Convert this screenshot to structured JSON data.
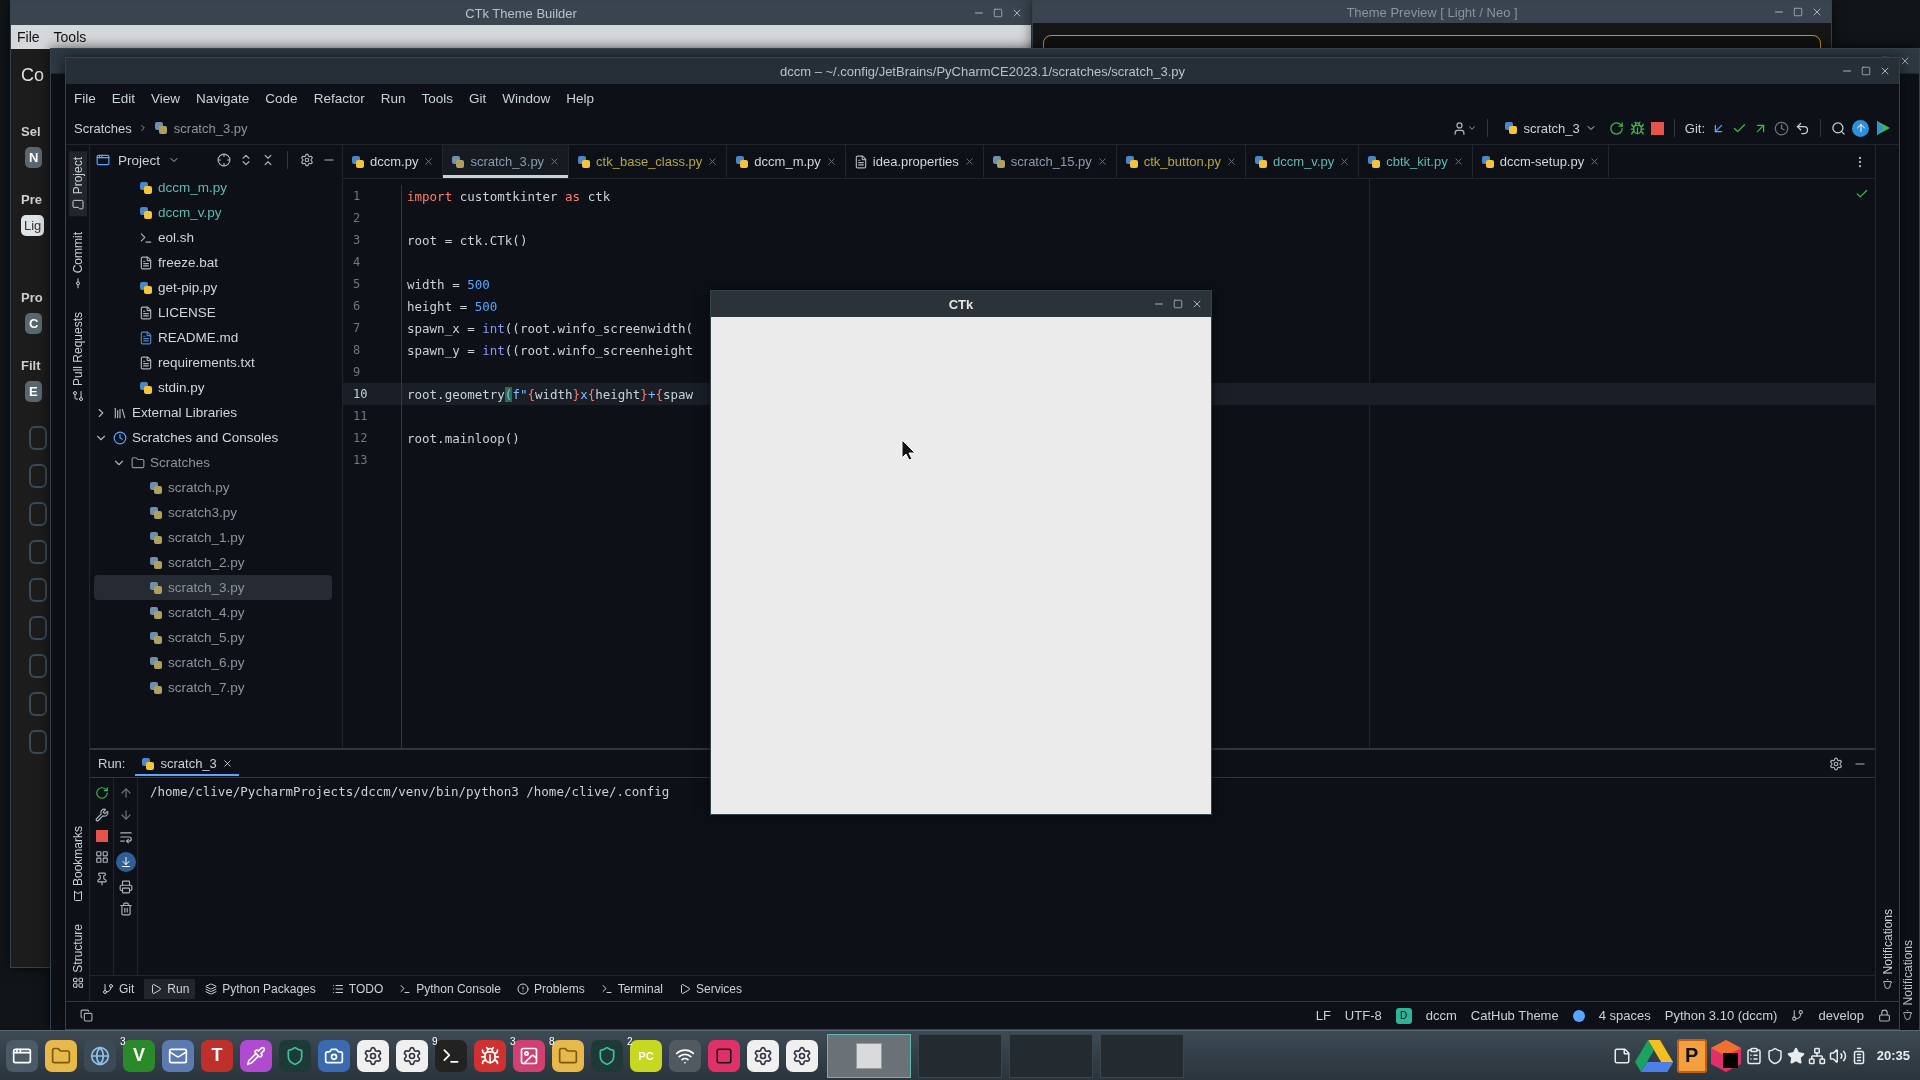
{
  "theme_builder": {
    "title": "CTk Theme Builder",
    "menu": [
      "File",
      "Tools"
    ],
    "fragments": [
      {
        "kind": "heading",
        "text": "Co"
      },
      {
        "kind": "label",
        "text": "Sel"
      },
      {
        "kind": "button",
        "text": "N"
      },
      {
        "kind": "label",
        "text": "Pre"
      },
      {
        "kind": "field",
        "text": "Lig"
      },
      {
        "kind": "label",
        "text": "Pro"
      },
      {
        "kind": "button",
        "text": "C"
      },
      {
        "kind": "label",
        "text": "Filt"
      },
      {
        "kind": "button",
        "text": "E"
      }
    ]
  },
  "theme_preview": {
    "title": "Theme Preview [ Light / Neo ]"
  },
  "background_ide": {
    "notifications": "Notifications"
  },
  "ide": {
    "title": "dccm – ~/.config/JetBrains/PyCharmCE2023.1/scratches/scratch_3.py",
    "menu": [
      "File",
      "Edit",
      "View",
      "Navigate",
      "Code",
      "Refactor",
      "Run",
      "Tools",
      "Git",
      "Window",
      "Help"
    ],
    "breadcrumbs": [
      "Scratches",
      "scratch_3.py"
    ],
    "run_config": "scratch_3",
    "git_label": "Git:",
    "left_strip_top": [
      {
        "label": "Project",
        "kind": "folder",
        "selected": true
      },
      {
        "label": "Commit",
        "kind": "commit",
        "selected": false
      },
      {
        "label": "Pull Requests",
        "kind": "pull",
        "selected": false
      }
    ],
    "left_strip_bottom": [
      {
        "label": "Bookmarks",
        "kind": "bookmark",
        "selected": false
      },
      {
        "label": "Structure",
        "kind": "structure",
        "selected": false
      }
    ],
    "project_panel": {
      "title": "Project",
      "files": [
        {
          "label": "dccm_m.py",
          "kind": "python",
          "color": "#5fb9b0",
          "selected": false
        },
        {
          "label": "dccm_v.py",
          "kind": "python",
          "color": "#5fb9b0",
          "selected": false
        },
        {
          "label": "eol.sh",
          "kind": "shell",
          "color": "#d0d6dc",
          "selected": false
        },
        {
          "label": "freeze.bat",
          "kind": "text",
          "color": "#d0d6dc",
          "selected": false
        },
        {
          "label": "get-pip.py",
          "kind": "python",
          "color": "#d0d6dc",
          "selected": false
        },
        {
          "label": "LICENSE",
          "kind": "text",
          "color": "#d0d6dc",
          "selected": false
        },
        {
          "label": "README.md",
          "kind": "markdown",
          "color": "#d0d6dc",
          "selected": false
        },
        {
          "label": "requirements.txt",
          "kind": "text",
          "color": "#d0d6dc",
          "selected": false
        },
        {
          "label": "stdin.py",
          "kind": "python",
          "color": "#d0d6dc",
          "selected": false
        }
      ],
      "tree": [
        {
          "label": "External Libraries",
          "kind": "library",
          "color": "#d0d6dc",
          "expanded": false,
          "selected": false
        },
        {
          "label": "Scratches and Consoles",
          "kind": "scratches",
          "color": "#d0d6dc",
          "expanded": true,
          "selected": false,
          "children": [
            {
              "label": "Scratches",
              "kind": "folder",
              "color": "#8b949e",
              "expanded": true,
              "selected": false,
              "children": [
                {
                  "label": "scratch.py",
                  "kind": "scratch",
                  "color": "#8b949e",
                  "selected": false
                },
                {
                  "label": "scratch3.py",
                  "kind": "scratch",
                  "color": "#8b949e",
                  "selected": false
                },
                {
                  "label": "scratch_1.py",
                  "kind": "scratch",
                  "color": "#8b949e",
                  "selected": false
                },
                {
                  "label": "scratch_2.py",
                  "kind": "scratch",
                  "color": "#8b949e",
                  "selected": false
                },
                {
                  "label": "scratch_3.py",
                  "kind": "scratch",
                  "color": "#8b949e",
                  "selected": true
                },
                {
                  "label": "scratch_4.py",
                  "kind": "scratch",
                  "color": "#8b949e",
                  "selected": false
                },
                {
                  "label": "scratch_5.py",
                  "kind": "scratch",
                  "color": "#8b949e",
                  "selected": false
                },
                {
                  "label": "scratch_6.py",
                  "kind": "scratch",
                  "color": "#8b949e",
                  "selected": false
                },
                {
                  "label": "scratch_7.py",
                  "kind": "scratch",
                  "color": "#8b949e",
                  "selected": false
                }
              ]
            }
          ]
        }
      ]
    },
    "tabs": [
      {
        "label": "dccm.py",
        "kind": "python",
        "color": "#d0d6dc",
        "selected": false
      },
      {
        "label": "scratch_3.py",
        "kind": "scratch",
        "color": "#8a9bb0",
        "selected": true
      },
      {
        "label": "ctk_base_class.py",
        "kind": "python",
        "color": "#b5a642",
        "selected": false
      },
      {
        "label": "dccm_m.py",
        "kind": "python",
        "color": "#d0d6dc",
        "selected": false
      },
      {
        "label": "idea.properties",
        "kind": "properties",
        "color": "#d0d6dc",
        "selected": false
      },
      {
        "label": "scratch_15.py",
        "kind": "scratch",
        "color": "#8a9bb0",
        "selected": false
      },
      {
        "label": "ctk_button.py",
        "kind": "python",
        "color": "#b5a642",
        "selected": false
      },
      {
        "label": "dccm_v.py",
        "kind": "python",
        "color": "#5fb9b0",
        "selected": false
      },
      {
        "label": "cbtk_kit.py",
        "kind": "python",
        "color": "#5fb9b0",
        "selected": false
      },
      {
        "label": "dccm-setup.py",
        "kind": "python",
        "color": "#d0d6dc",
        "selected": false
      }
    ],
    "code": [
      {
        "number": "1",
        "current": false,
        "tokens": [
          {
            "kind": "keyword",
            "text": "import"
          },
          {
            "kind": "plain",
            "text": " customtkinter "
          },
          {
            "kind": "keyword",
            "text": "as"
          },
          {
            "kind": "plain",
            "text": " ctk"
          }
        ]
      },
      {
        "number": "2",
        "current": false
      },
      {
        "number": "3",
        "current": false,
        "tokens": [
          {
            "kind": "plain",
            "text": "root = ctk.CTk()"
          }
        ]
      },
      {
        "number": "4",
        "current": false
      },
      {
        "number": "5",
        "current": false,
        "tokens": [
          {
            "kind": "plain",
            "text": "width = "
          },
          {
            "kind": "number",
            "text": "500"
          }
        ]
      },
      {
        "number": "6",
        "current": false,
        "tokens": [
          {
            "kind": "plain",
            "text": "height = "
          },
          {
            "kind": "number",
            "text": "500"
          }
        ]
      },
      {
        "number": "7",
        "current": false,
        "tokens": [
          {
            "kind": "plain",
            "text": "spawn_x = "
          },
          {
            "kind": "builtin",
            "text": "int"
          },
          {
            "kind": "plain",
            "text": "((root.winfo_screenwidth("
          }
        ]
      },
      {
        "number": "8",
        "current": false,
        "tokens": [
          {
            "kind": "plain",
            "text": "spawn_y = "
          },
          {
            "kind": "builtin",
            "text": "int"
          },
          {
            "kind": "plain",
            "text": "((root.winfo_screenheight"
          }
        ]
      },
      {
        "number": "9",
        "current": false
      },
      {
        "number": "10",
        "current": true,
        "tokens": [
          {
            "kind": "plain",
            "text": "root.geometry"
          },
          {
            "kind": "match",
            "text": "("
          },
          {
            "kind": "string",
            "text": "f\""
          },
          {
            "kind": "brace",
            "text": "{"
          },
          {
            "kind": "plain",
            "text": "width"
          },
          {
            "kind": "brace",
            "text": "}"
          },
          {
            "kind": "string",
            "text": "x"
          },
          {
            "kind": "brace",
            "text": "{"
          },
          {
            "kind": "plain",
            "text": "height"
          },
          {
            "kind": "brace",
            "text": "}"
          },
          {
            "kind": "string",
            "text": "+"
          },
          {
            "kind": "brace",
            "text": "{"
          },
          {
            "kind": "plain",
            "text": "spaw"
          }
        ]
      },
      {
        "number": "11",
        "current": false
      },
      {
        "number": "12",
        "current": false,
        "tokens": [
          {
            "kind": "plain",
            "text": "root.mainloop()"
          }
        ]
      },
      {
        "number": "13",
        "current": false
      }
    ],
    "run_panel": {
      "label": "Run:",
      "tab": "scratch_3",
      "output": "/home/clive/PycharmProjects/dccm/venv/bin/python3 /home/clive/.config"
    },
    "tool_windows": [
      {
        "label": "Git",
        "kind": "git",
        "selected": false
      },
      {
        "label": "Run",
        "kind": "run",
        "selected": true
      },
      {
        "label": "Python Packages",
        "kind": "packages",
        "selected": false
      },
      {
        "label": "TODO",
        "kind": "todo",
        "selected": false
      },
      {
        "label": "Python Console",
        "kind": "console",
        "selected": false
      },
      {
        "label": "Problems",
        "kind": "problems",
        "selected": false
      },
      {
        "label": "Terminal",
        "kind": "terminal",
        "selected": false
      },
      {
        "label": "Services",
        "kind": "services",
        "selected": false
      }
    ],
    "status": {
      "line_sep": "LF",
      "encoding": "UTF-8",
      "project_badge": "D",
      "project": "dccm",
      "theme": "CatHub Theme",
      "indent": "4 spaces",
      "interpreter": "Python 3.10 (dccm)",
      "branch": "develop"
    },
    "notifications": "Notifications"
  },
  "ctk_window": {
    "title": "CTk"
  },
  "taskbar": {
    "apps": [
      {
        "kind": "menu",
        "color": "#4a5a66"
      },
      {
        "kind": "folder",
        "color": "#e8b84a"
      },
      {
        "kind": "globe",
        "color": "#3b4a55"
      },
      {
        "kind": "letter",
        "color": "#2a8a2a",
        "label": "V",
        "badge": "3"
      },
      {
        "kind": "mail",
        "color": "#5a7ab0"
      },
      {
        "kind": "letter",
        "color": "#c0302a",
        "label": "T"
      },
      {
        "kind": "picker",
        "color": "#b04ad0"
      },
      {
        "kind": "octopus",
        "color": "#1e3a36"
      },
      {
        "kind": "camera",
        "color": "#3a6ab0"
      },
      {
        "kind": "gear",
        "color": "#f0f0f0"
      },
      {
        "kind": "gear",
        "color": "#f0f0f0"
      },
      {
        "kind": "terminal",
        "color": "#222222",
        "badge": "9"
      },
      {
        "kind": "ghost",
        "color": "#d03030"
      },
      {
        "kind": "image",
        "color": "#d04070",
        "badge": "3"
      },
      {
        "kind": "folder",
        "color": "#e8b84a",
        "badge": "8"
      },
      {
        "kind": "octopus",
        "color": "#1e3a36"
      },
      {
        "kind": "letter",
        "color": "#c8d820",
        "label": "PC",
        "badge": "2"
      },
      {
        "kind": "wifi",
        "color": "#505a60"
      },
      {
        "kind": "cube",
        "color": "#e0306a"
      },
      {
        "kind": "gear",
        "color": "#f0f0f0"
      },
      {
        "kind": "gear",
        "color": "#f0f0f0"
      }
    ],
    "windows": [
      {
        "selected": true
      },
      {
        "selected": false
      },
      {
        "selected": false
      },
      {
        "selected": false
      }
    ],
    "tray_label": "P",
    "clock": "20:35"
  }
}
